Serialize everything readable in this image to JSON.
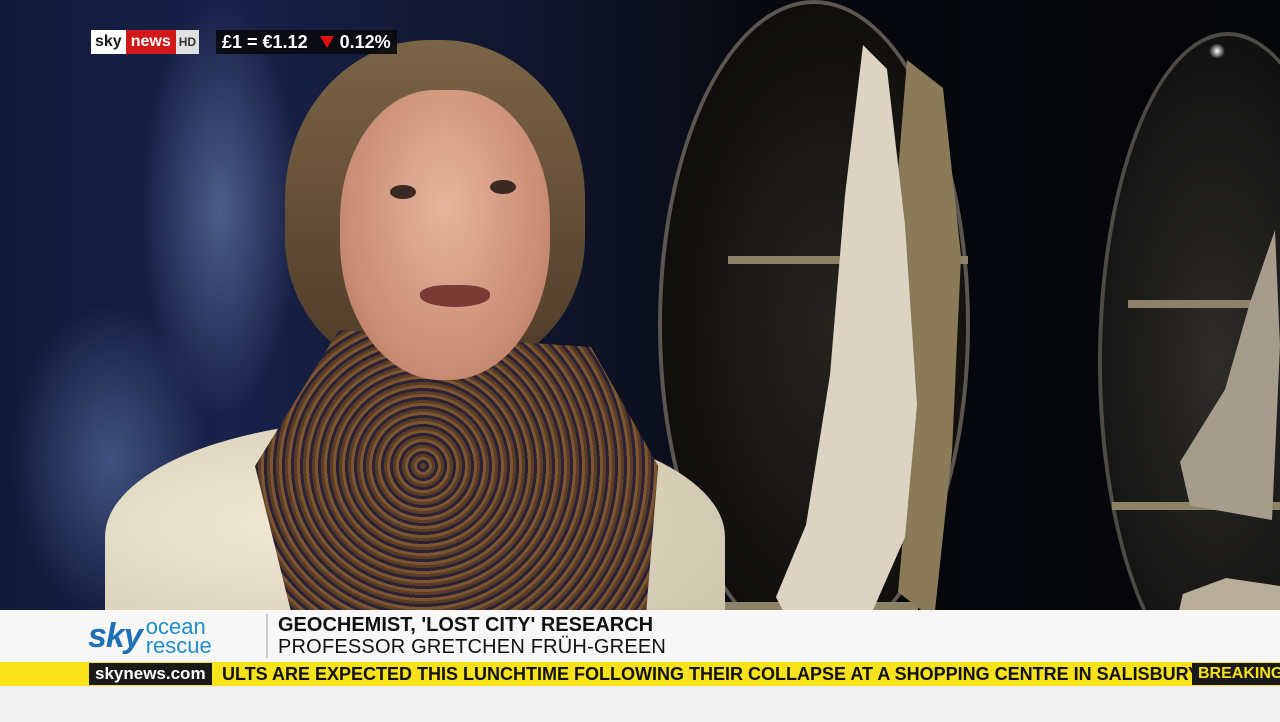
{
  "channel": {
    "sky": "sky",
    "news": "news",
    "hd": "HD"
  },
  "currency_ticker": {
    "text": "£1 = €1.12",
    "change": "0.12%",
    "direction": "down"
  },
  "lower_third": {
    "brand_sky": "sky",
    "brand_ocean_line1": "ocean",
    "brand_ocean_line2": "rescue",
    "headline": "GEOCHEMIST, 'LOST CITY' RESEARCH",
    "name": "PROFESSOR GRETCHEN FRÜH-GREEN"
  },
  "crawler": {
    "site": "skynews.com",
    "text": "ULTS ARE EXPECTED THIS LUNCHTIME FOLLOWING THEIR COLLAPSE AT A SHOPPING CENTRE IN SALISBURY",
    "breaking": "BREAKING"
  },
  "colors": {
    "sky_red": "#d2191a",
    "crawl_yellow": "#f8e21b",
    "down_red": "#e01010"
  }
}
